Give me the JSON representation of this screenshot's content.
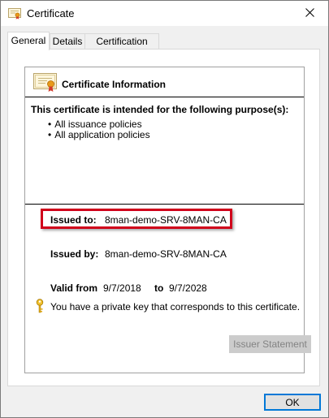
{
  "window": {
    "title": "Certificate",
    "close_glyph": "✕"
  },
  "tabs": [
    {
      "label": "General",
      "active": true
    },
    {
      "label": "Details",
      "active": false
    },
    {
      "label": "Certification Path",
      "active": false
    }
  ],
  "general": {
    "header_title": "Certificate Information",
    "purpose_heading": "This certificate is intended for the following purpose(s):",
    "purposes": [
      "All issuance policies",
      "All application policies"
    ],
    "issued_to_label": "Issued to:",
    "issued_to_value": "8man-demo-SRV-8MAN-CA",
    "issued_by_label": "Issued by:",
    "issued_by_value": "8man-demo-SRV-8MAN-CA",
    "valid_from_label": "Valid from",
    "valid_from_value": "9/7/2018",
    "valid_to_label": "to",
    "valid_to_value": "9/7/2028",
    "private_key_note": "You have a private key that corresponds to this certificate.",
    "issuer_statement_button": "Issuer Statement",
    "issuer_statement_enabled": false
  },
  "footer": {
    "ok_button": "OK"
  },
  "icons": {
    "title": "certificate-icon",
    "header": "certificate-icon",
    "key": "key-icon",
    "close": "close-icon"
  },
  "colors": {
    "highlight_border": "#d0021b",
    "ok_border": "#0078d7",
    "disabled_text": "#838383"
  }
}
